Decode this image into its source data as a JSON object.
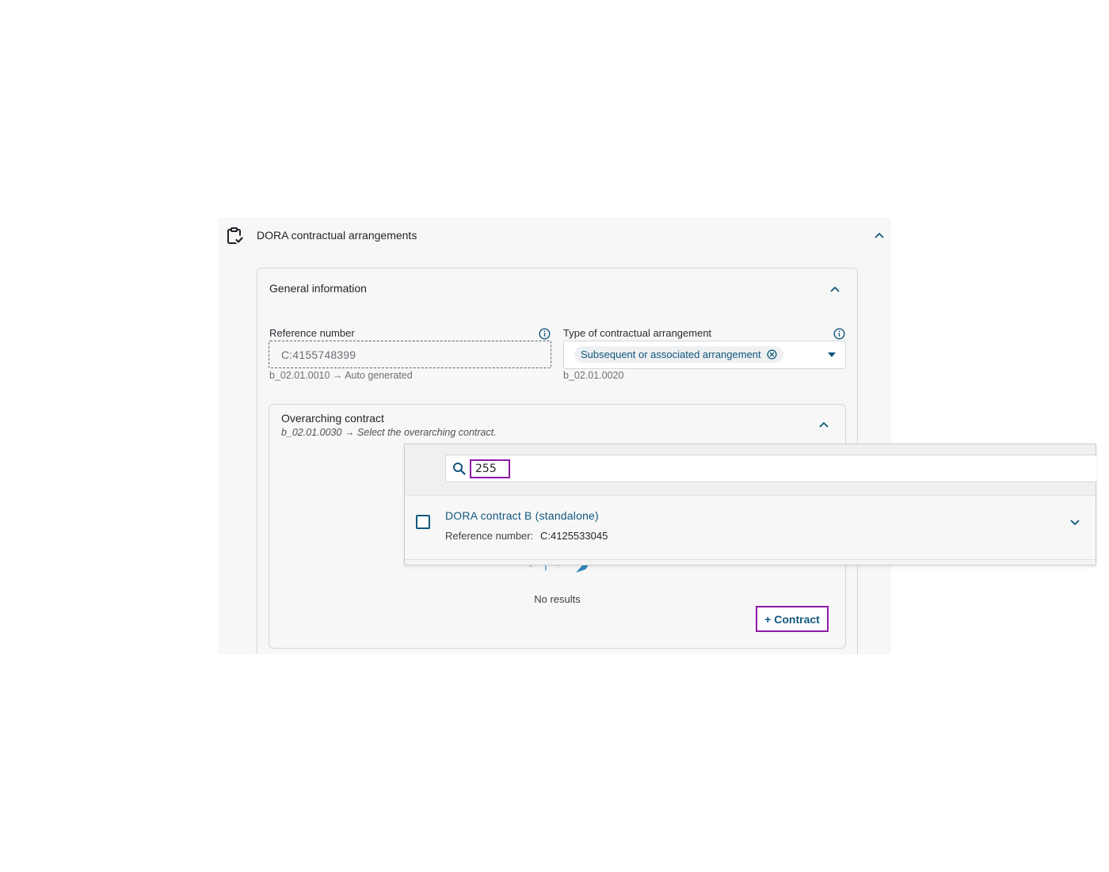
{
  "section": {
    "title": "DORA contractual arrangements",
    "icon": "clipboard-check-icon"
  },
  "general_info": {
    "title": "General information",
    "reference_number": {
      "label": "Reference number",
      "value": "C:4155748399",
      "hint": "b_02.01.0010 → Auto generated"
    },
    "contract_type": {
      "label": "Type of contractual arrangement",
      "selected": "Subsequent or associated arrangement",
      "hint": "b_02.01.0020"
    }
  },
  "overarching": {
    "title": "Overarching contract",
    "hint": "b_02.01.0030 → Select the overarching contract.",
    "empty_text": "No results",
    "add_button": "+ Contract"
  },
  "dropdown": {
    "search_value": "255",
    "results": [
      {
        "title": "DORA contract B (standalone)",
        "meta_label": "Reference number:",
        "meta_value": "C:4125533045"
      }
    ]
  },
  "colors": {
    "accent": "#11577d",
    "focus": "#8e1aa7",
    "panel_bg": "#f7f7f7"
  }
}
